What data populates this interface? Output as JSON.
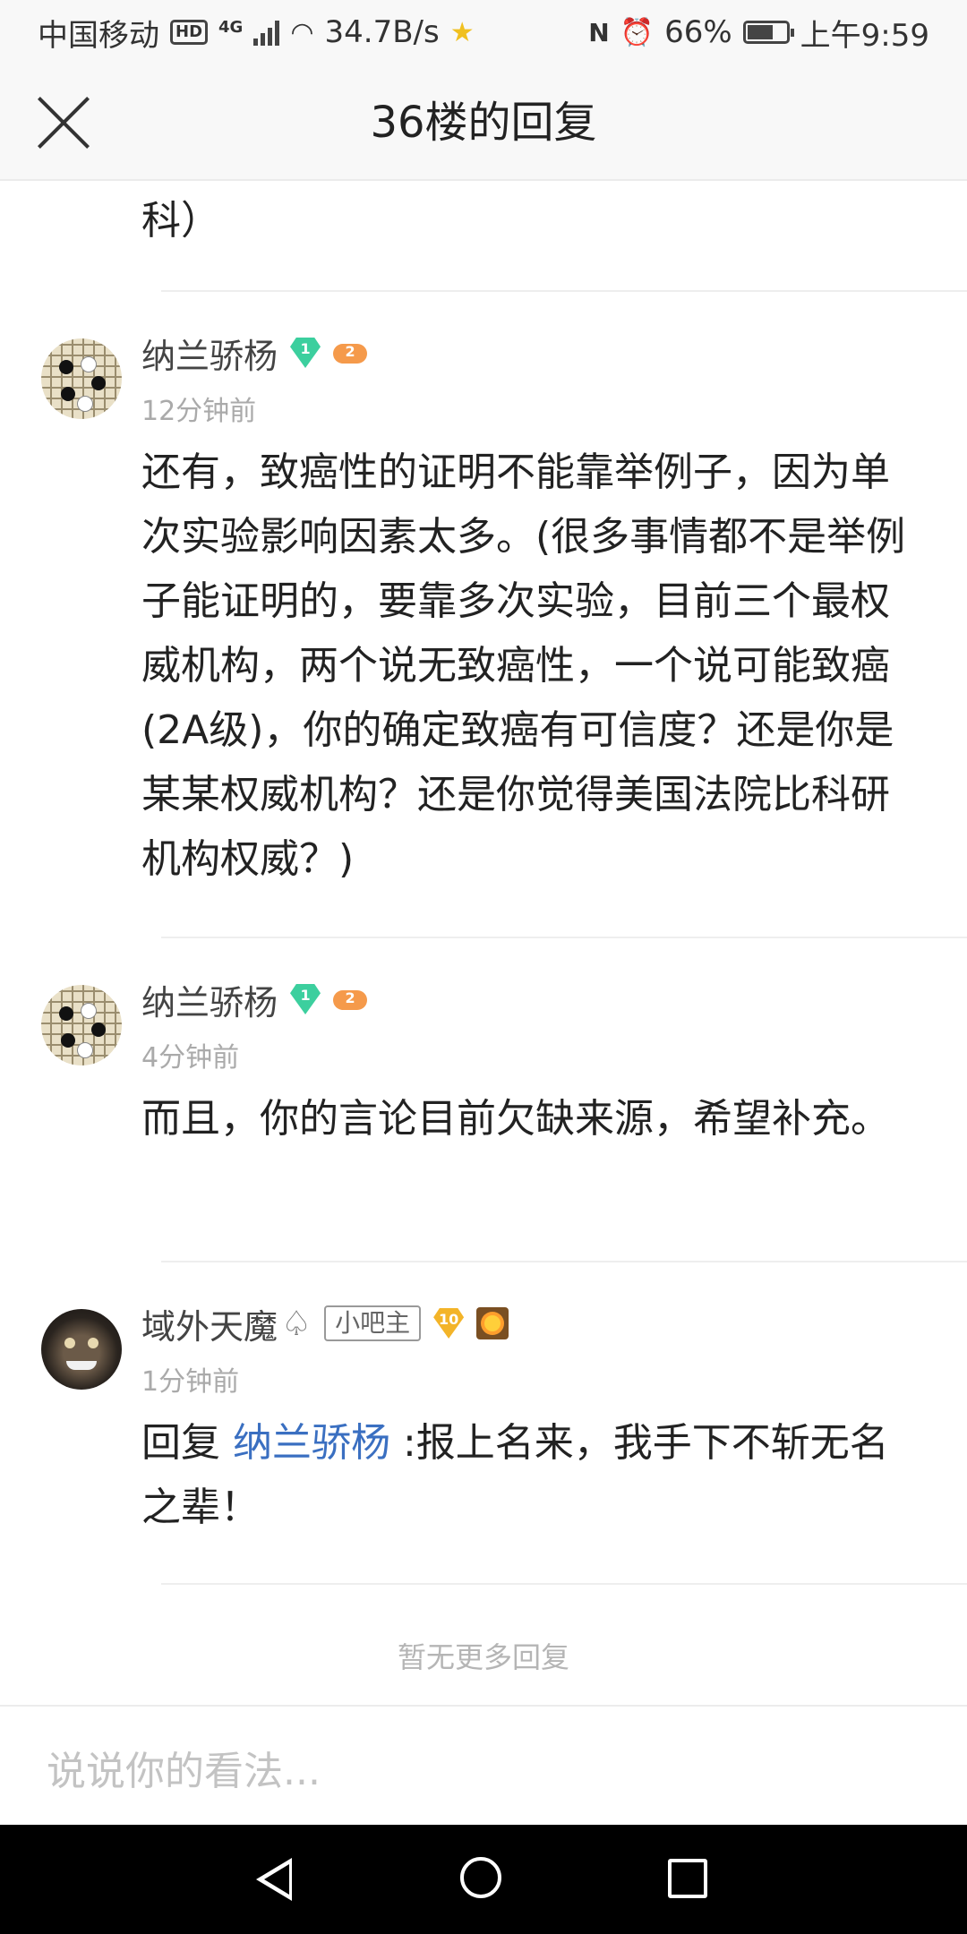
{
  "status_bar": {
    "carrier": "中国移动",
    "hd": "HD",
    "network": "4G",
    "speed": "34.7B/s",
    "battery": "66%",
    "battery_level": 0.66,
    "time": "上午9:59"
  },
  "header": {
    "title": "36楼的回复"
  },
  "top_fragment": "科）",
  "replies": [
    {
      "username": "纳兰骄杨",
      "level_badge": "1",
      "badge_num": "2",
      "time": "12分钟前",
      "text": "还有，致癌性的证明不能靠举例子，因为单次实验影响因素太多。(很多事情都不是举例子能证明的，要靠多次实验，目前三个最权威机构，两个说无致癌性，一个说可能致癌(2A级)，你的确定致癌有可信度？还是你是某某权威机构？还是你觉得美国法院比科研机构权威？)"
    },
    {
      "username": "纳兰骄杨",
      "level_badge": "1",
      "badge_num": "2",
      "time": "4分钟前",
      "text": "而且，你的言论目前欠缺来源，希望补充。"
    },
    {
      "username": "域外天魔",
      "owner_label": "小吧主",
      "level_badge": "10",
      "time": "1分钟前",
      "reply_prefix": "回复 ",
      "mention": "纳兰骄杨",
      "text": " :报上名来，我手下不斩无名之辈！"
    }
  ],
  "no_more": "暂无更多回复",
  "input": {
    "placeholder": "说说你的看法..."
  },
  "icons": [
    "close-icon",
    "diamond-level-icon",
    "gamepad-badge-icon",
    "spade-icon",
    "sun-badge-icon",
    "back-nav-icon",
    "home-nav-icon",
    "recent-apps-icon"
  ]
}
